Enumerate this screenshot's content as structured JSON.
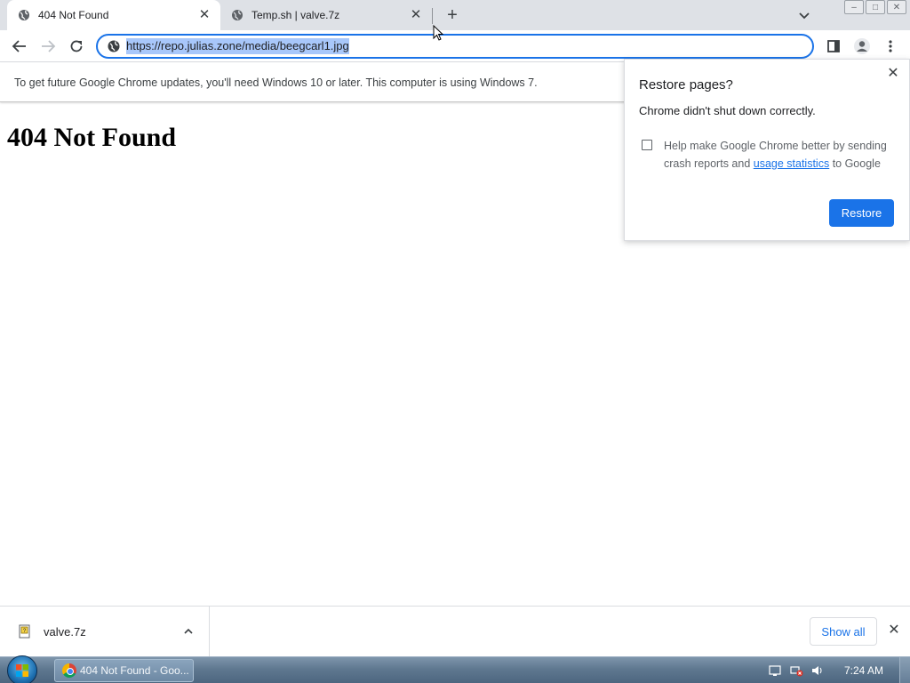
{
  "tabs": [
    {
      "title": "404 Not Found",
      "active": true
    },
    {
      "title": "Temp.sh | valve.7z",
      "active": false
    }
  ],
  "window_controls": {
    "minimize": "–",
    "maximize": "□",
    "close": "✕"
  },
  "toolbar": {
    "url": "https://repo.julias.zone/media/beegcarl1.jpg"
  },
  "infobar": {
    "message": "To get future Google Chrome updates, you'll need Windows 10 or later. This computer is using Windows 7."
  },
  "page": {
    "heading": "404 Not Found"
  },
  "restore_bubble": {
    "title": "Restore pages?",
    "message": "Chrome didn't shut down correctly.",
    "consent_before": "Help make Google Chrome better by sending crash reports and ",
    "consent_link": "usage statistics",
    "consent_after": " to Google",
    "restore_label": "Restore",
    "checkbox_checked": false
  },
  "download_shelf": {
    "file_name": "valve.7z",
    "show_all_label": "Show all"
  },
  "taskbar": {
    "task_label": "404 Not Found - Goo...",
    "clock": "7:24 AM"
  },
  "colors": {
    "accent": "#1a73e8",
    "tabstrip": "#dee1e6",
    "url_selection": "#a8c7fa"
  },
  "icons": [
    "globe-icon",
    "back-arrow-icon",
    "forward-arrow-icon",
    "reload-icon",
    "side-panel-icon",
    "profile-icon",
    "menu-kebab-icon",
    "close-icon",
    "plus-icon",
    "chevron-down-icon",
    "chevron-up-icon",
    "file-icon",
    "start-orb-icon",
    "chrome-icon"
  ]
}
